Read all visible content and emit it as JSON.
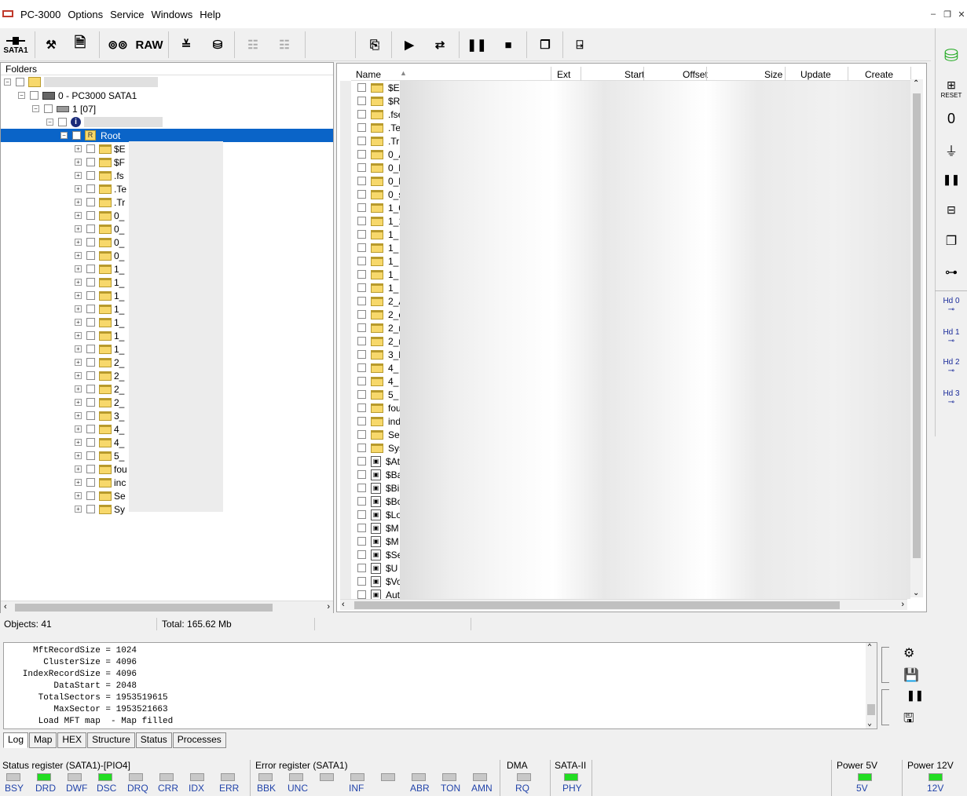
{
  "app": {
    "title": "PC-3000"
  },
  "menu": [
    "Options",
    "Service",
    "Windows",
    "Help"
  ],
  "window_buttons": [
    "–",
    "❐",
    "✕"
  ],
  "toolbar": {
    "sata_label": "SATA1",
    "raw_label": "RAW"
  },
  "folders_header": "Folders",
  "tree": {
    "node0": "0 - PC3000 SATA1",
    "node1": "1 [07]",
    "root": "Root",
    "children": [
      "$E",
      "$F",
      ".fs",
      ".Te",
      ".Tr",
      "0_",
      "0_",
      "0_",
      "0_",
      "1_",
      "1_",
      "1_",
      "1_",
      "1_",
      "1_",
      "1_",
      "2_",
      "2_",
      "2_",
      "2_",
      "3_",
      "4_",
      "4_",
      "5_",
      "fou",
      "inc",
      "Se",
      "Sy"
    ]
  },
  "file_list": {
    "columns": [
      "Name",
      "Ext",
      "Start",
      "Offset",
      "Size",
      "Update",
      "Create"
    ],
    "rows": [
      {
        "name": "$Ex",
        "type": "folder"
      },
      {
        "name": "$R",
        "type": "folder"
      },
      {
        "name": ".fse",
        "type": "folder"
      },
      {
        "name": ".Te",
        "type": "folder"
      },
      {
        "name": ".Tr",
        "type": "folder"
      },
      {
        "name": "0_A",
        "type": "folder"
      },
      {
        "name": "0_l",
        "type": "folder"
      },
      {
        "name": "0_l",
        "type": "folder"
      },
      {
        "name": "0_s",
        "type": "folder"
      },
      {
        "name": "1_0",
        "type": "folder"
      },
      {
        "name": "1_1",
        "type": "folder"
      },
      {
        "name": "1_",
        "type": "folder"
      },
      {
        "name": "1_",
        "type": "folder"
      },
      {
        "name": "1_",
        "type": "folder"
      },
      {
        "name": "1_",
        "type": "folder"
      },
      {
        "name": "1_",
        "type": "folder"
      },
      {
        "name": "2_A",
        "type": "folder"
      },
      {
        "name": "2_c",
        "type": "folder"
      },
      {
        "name": "2_n",
        "type": "folder"
      },
      {
        "name": "2_n",
        "type": "folder"
      },
      {
        "name": "3_b",
        "type": "folder"
      },
      {
        "name": "4_",
        "type": "folder"
      },
      {
        "name": "4_",
        "type": "folder"
      },
      {
        "name": "5_",
        "type": "folder"
      },
      {
        "name": "fou",
        "type": "folder"
      },
      {
        "name": "ind",
        "type": "folder"
      },
      {
        "name": "Sea",
        "type": "folder"
      },
      {
        "name": "Sys",
        "type": "folder"
      },
      {
        "name": "$At",
        "type": "file"
      },
      {
        "name": "$Ba",
        "type": "file"
      },
      {
        "name": "$Bi",
        "type": "file"
      },
      {
        "name": "$Bo",
        "type": "file"
      },
      {
        "name": "$Lo",
        "type": "file"
      },
      {
        "name": "$M",
        "type": "file"
      },
      {
        "name": "$M",
        "type": "file"
      },
      {
        "name": "$Se",
        "type": "file"
      },
      {
        "name": "$U",
        "type": "file"
      },
      {
        "name": "$Vo",
        "type": "file"
      },
      {
        "name": "Aut",
        "type": "file"
      }
    ]
  },
  "status": {
    "objects": "Objects: 41",
    "total": "Total: 165.62 Mb"
  },
  "log": [
    "     MftRecordSize = 1024",
    "       ClusterSize = 4096",
    "   IndexRecordSize = 4096",
    "         DataStart = 2048",
    "      TotalSectors = 1953519615",
    "         MaxSector = 1953521663",
    "      Load MFT map  - Map filled"
  ],
  "tabs": [
    "Log",
    "Map",
    "HEX",
    "Structure",
    "Status",
    "Processes"
  ],
  "registers": {
    "status_title": "Status register (SATA1)-[PIO4]",
    "status_leds": [
      {
        "label": "BSY",
        "on": false
      },
      {
        "label": "DRD",
        "on": true
      },
      {
        "label": "DWF",
        "on": false
      },
      {
        "label": "DSC",
        "on": true
      },
      {
        "label": "DRQ",
        "on": false
      },
      {
        "label": "CRR",
        "on": false
      },
      {
        "label": "IDX",
        "on": false
      },
      {
        "label": "ERR",
        "on": false
      }
    ],
    "error_title": "Error register (SATA1)",
    "error_leds": [
      {
        "label": "BBK",
        "on": false
      },
      {
        "label": "UNC",
        "on": false
      },
      {
        "label": "",
        "on": false
      },
      {
        "label": "INF",
        "on": false
      },
      {
        "label": "",
        "on": false
      },
      {
        "label": "ABR",
        "on": false
      },
      {
        "label": "TON",
        "on": false
      },
      {
        "label": "AMN",
        "on": false
      }
    ],
    "dma_title": "DMA",
    "dma_led": {
      "label": "RQ",
      "on": false
    },
    "sata_title": "SATA-II",
    "sata_led": {
      "label": "PHY",
      "on": true
    },
    "p5_title": "Power 5V",
    "p5_led": {
      "label": "5V",
      "on": true
    },
    "p12_title": "Power 12V",
    "p12_led": {
      "label": "12V",
      "on": true
    }
  },
  "sidebar": {
    "reset_label": "RESET",
    "hd_labels": [
      "Hd 0",
      "Hd 1",
      "Hd 2",
      "Hd 3"
    ]
  },
  "colors": {
    "led_on": "#22dd22",
    "led_off": "#c8c8c8",
    "selection": "#0a64c8",
    "folder": "#f7d86b"
  }
}
